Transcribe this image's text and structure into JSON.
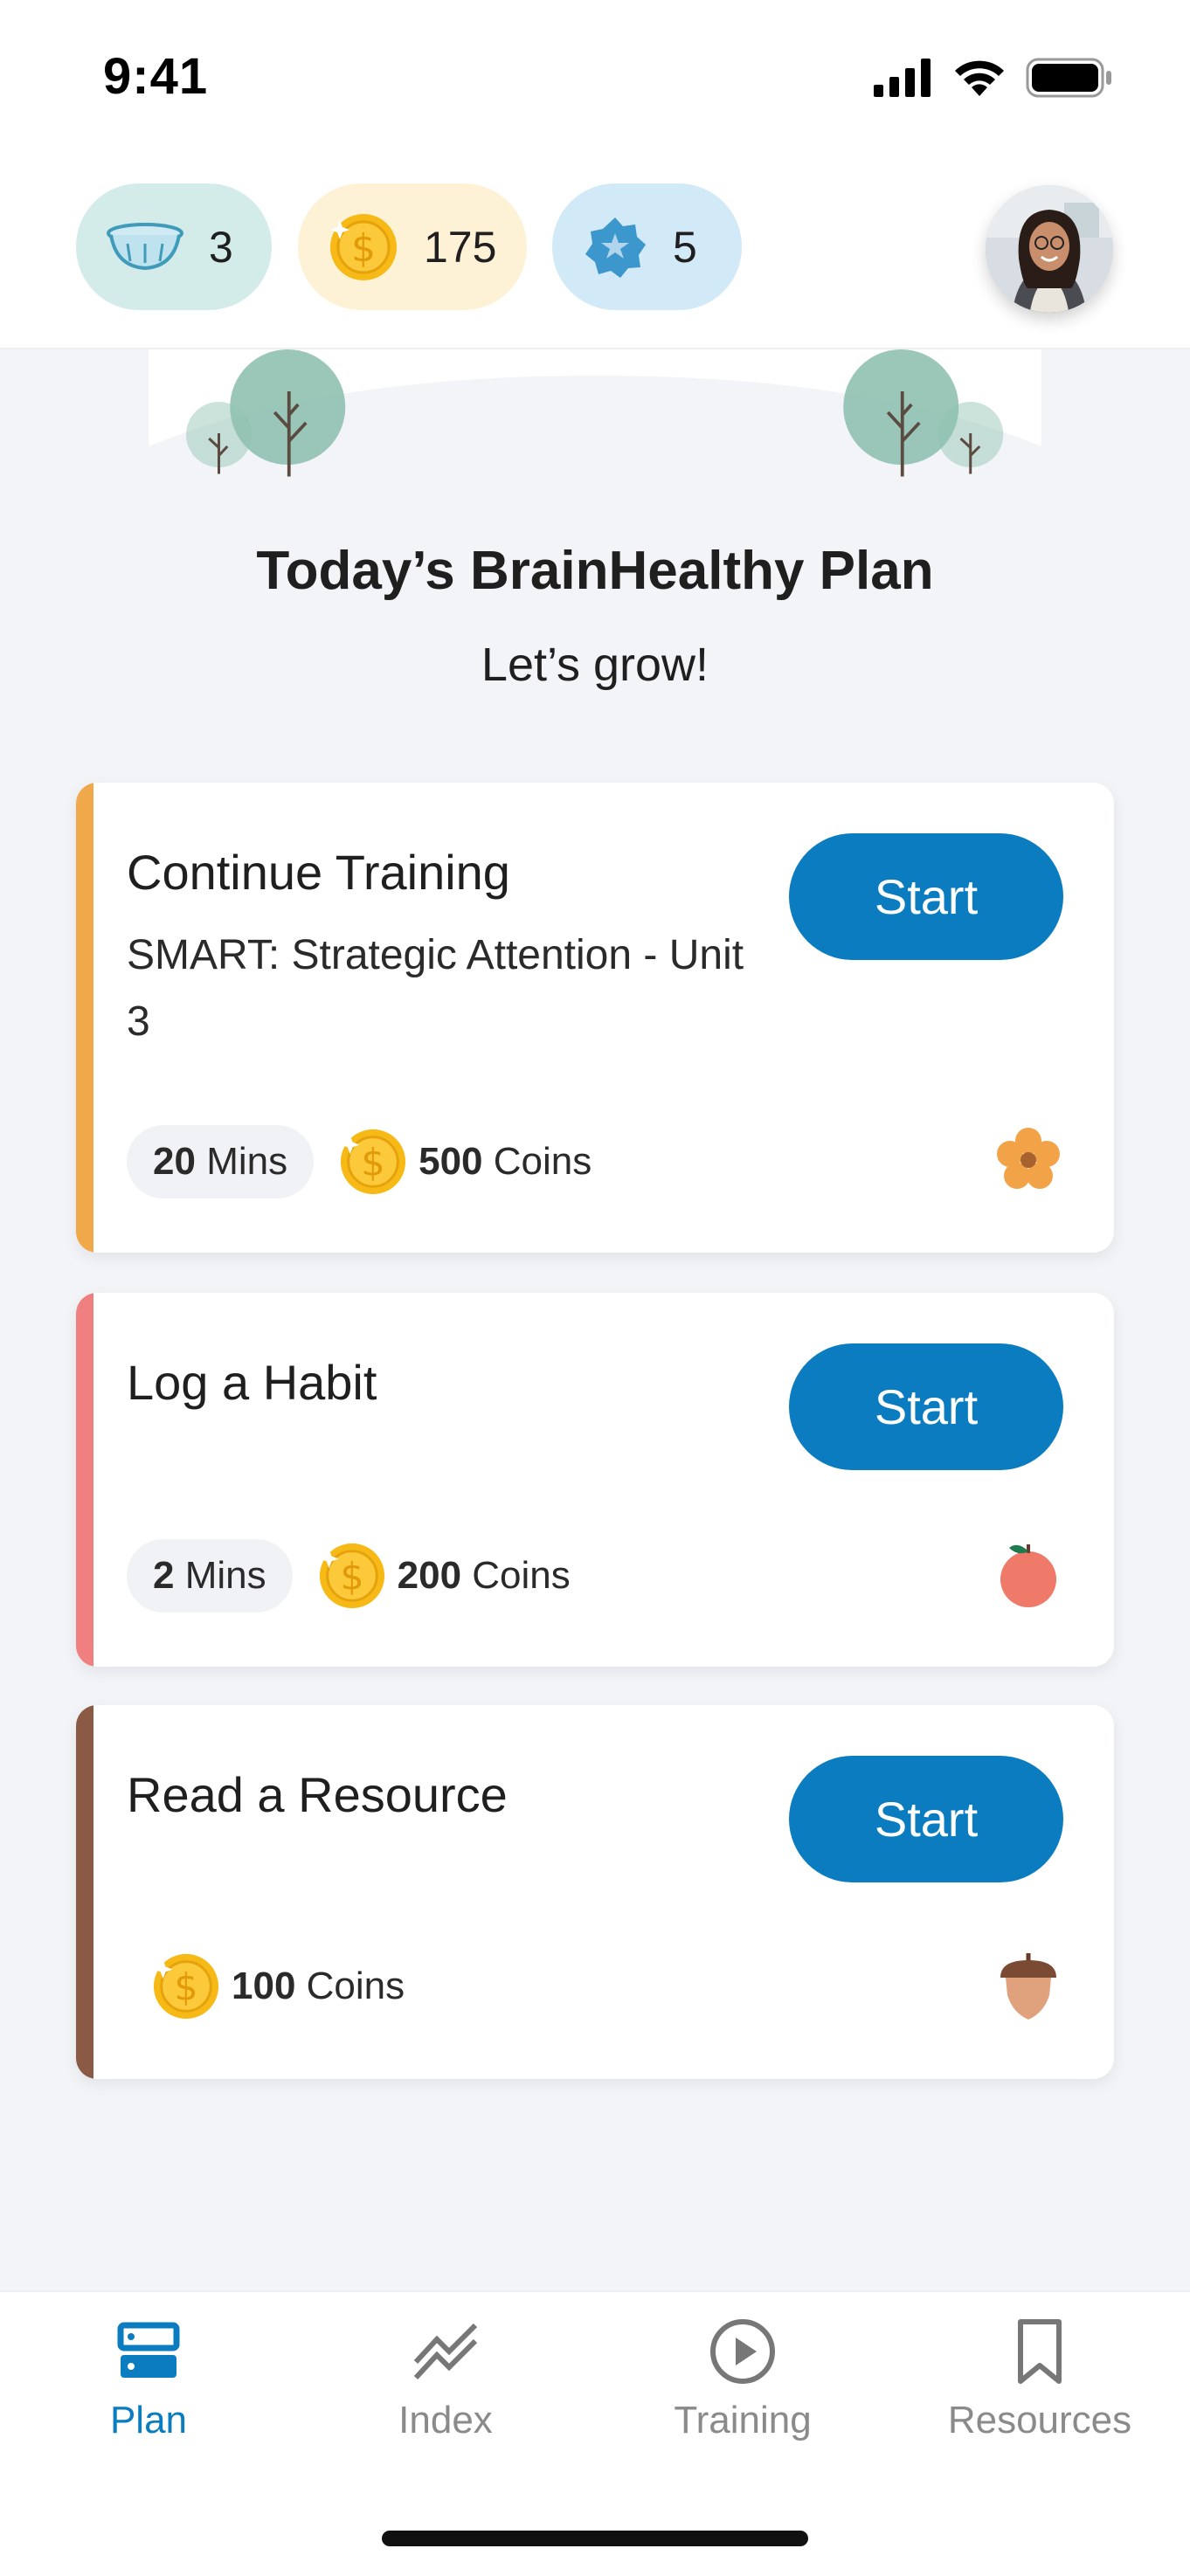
{
  "status_bar": {
    "time": "9:41",
    "icons": [
      "signal-icon",
      "wifi-icon",
      "battery-icon"
    ]
  },
  "header": {
    "pills": [
      {
        "icon": "bowl-icon",
        "count": "3",
        "color": "#d3ecea"
      },
      {
        "icon": "coin-icon",
        "count": "175",
        "color": "#fdf2d6"
      },
      {
        "icon": "star-badge-icon",
        "count": "5",
        "color": "#d2e9f7"
      }
    ],
    "avatar": "profile-avatar"
  },
  "hero": {
    "title": "Today’s BrainHealthy Plan",
    "subtitle": "Let’s grow!"
  },
  "cards": [
    {
      "title": "Continue Training",
      "subtitle": "SMART: Strategic Attention - Unit 3",
      "start_label": "Start",
      "mins_value": "20",
      "mins_unit": "Mins",
      "coins_value": "500",
      "coins_unit": "Coins",
      "icon": "flower-icon",
      "accent": "#f0a94a"
    },
    {
      "title": "Log a Habit",
      "start_label": "Start",
      "mins_value": "2",
      "mins_unit": "Mins",
      "coins_value": "200",
      "coins_unit": "Coins",
      "icon": "apple-icon",
      "accent": "#f08080"
    },
    {
      "title": "Read a Resource",
      "start_label": "Start",
      "coins_value": "100",
      "coins_unit": "Coins",
      "icon": "acorn-icon",
      "accent": "#8a5a44"
    }
  ],
  "nav": {
    "items": [
      {
        "label": "Plan",
        "icon": "plan-icon",
        "active": true
      },
      {
        "label": "Index",
        "icon": "index-chart-icon",
        "active": false
      },
      {
        "label": "Training",
        "icon": "play-icon",
        "active": false
      },
      {
        "label": "Resources",
        "icon": "bookmark-icon",
        "active": false
      }
    ],
    "active_color": "#0a7cbf",
    "inactive_color": "#8a8a8a"
  },
  "colors": {
    "primary_button": "#0a7cbf",
    "background": "#f3f4f8",
    "tree": "#8fc1b0"
  }
}
